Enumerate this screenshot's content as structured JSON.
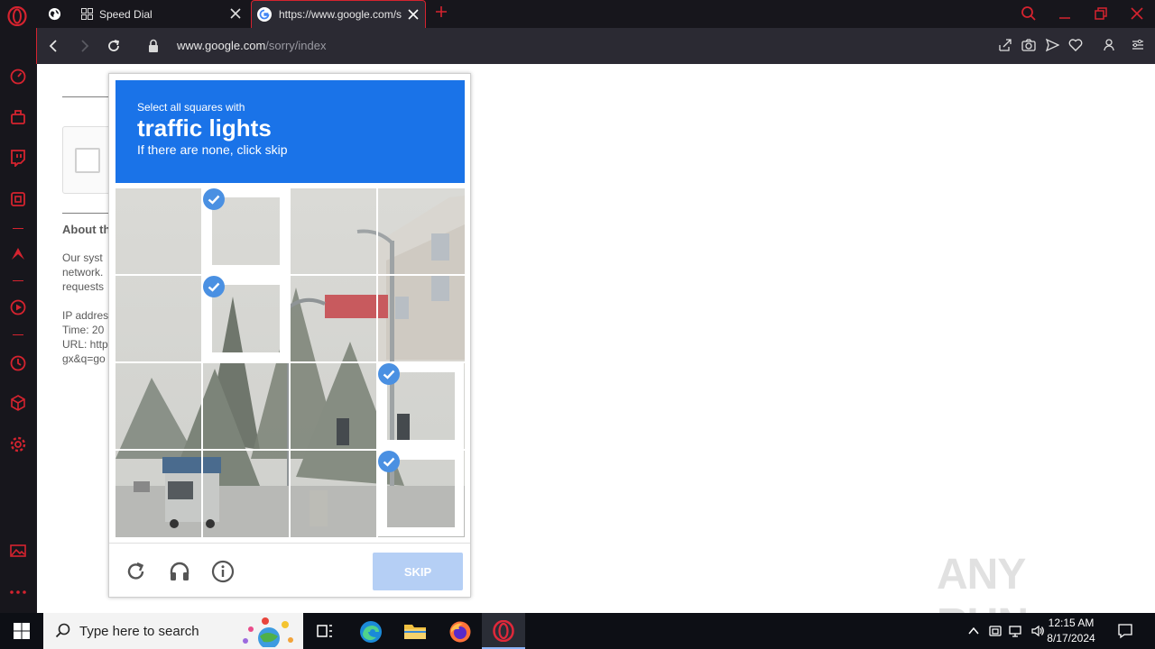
{
  "browser": {
    "tabs": [
      {
        "label": "Speed Dial"
      },
      {
        "label": "https://www.google.com/s"
      }
    ],
    "url_host": "www.google.com",
    "url_path": "/sorry/index"
  },
  "page": {
    "about_heading": "About th",
    "body_lines": [
      "Our syst",
      "network.",
      "requests"
    ],
    "info_lines": [
      "IP addres",
      "Time: 20",
      "URL: http",
      "gx&q=go"
    ]
  },
  "captcha": {
    "instruction_line1": "Select all squares with",
    "target": "traffic lights",
    "instruction_line3": "If there are none, click skip",
    "skip_label": "SKIP",
    "selected_tiles": [
      1,
      5,
      11,
      15
    ],
    "accent_color": "#1a73e8",
    "footer_icons": [
      "reload-icon",
      "audio-icon",
      "info-icon"
    ]
  },
  "watermark": "ANY RUN",
  "taskbar": {
    "search_placeholder": "Type here to search",
    "time": "12:15 AM",
    "date": "8/17/2024"
  }
}
